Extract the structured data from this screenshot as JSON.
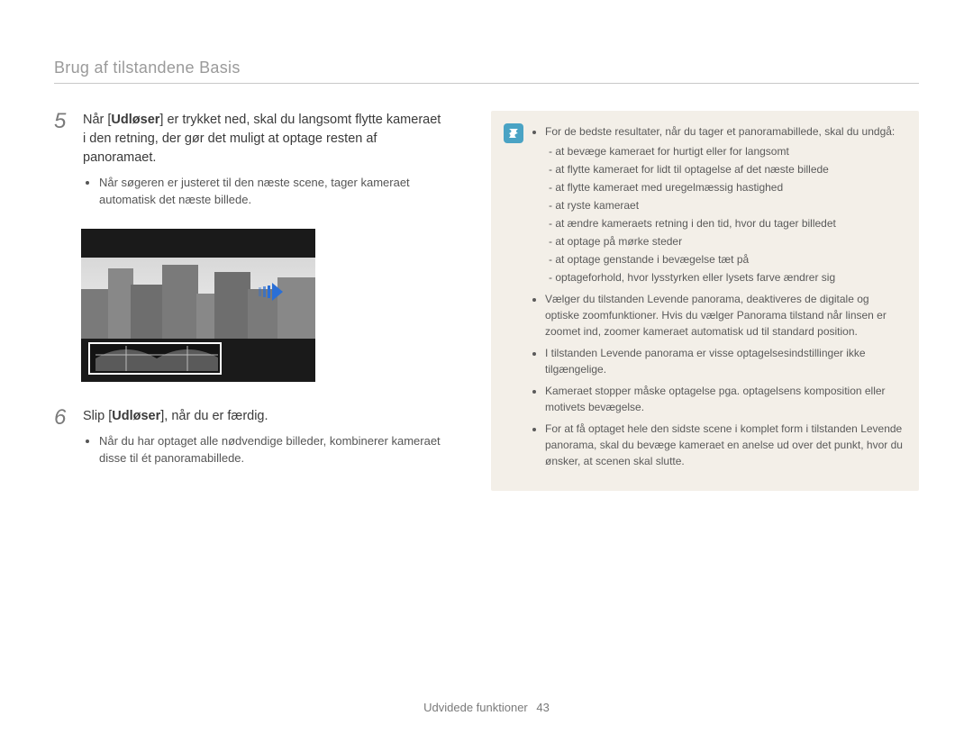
{
  "header": {
    "title": "Brug af tilstandene Basis"
  },
  "steps": {
    "s5": {
      "num": "5",
      "text_pre": "Når [",
      "text_bold": "Udløser",
      "text_post": "] er trykket ned, skal du langsomt flytte kameraet i den retning, der gør det muligt at optage resten af panoramaet.",
      "bullets": [
        "Når søgeren er justeret til den næste scene, tager kameraet automatisk det næste billede."
      ]
    },
    "s6": {
      "num": "6",
      "text_pre": "Slip [",
      "text_bold": "Udløser",
      "text_post": "], når du er færdig.",
      "bullets": [
        "Når du har optaget alle nødvendige billeder, kombinerer kameraet disse til ét panoramabillede."
      ]
    }
  },
  "note": {
    "intro": "For de bedste resultater, når du tager et panoramabillede, skal du undgå:",
    "avoid": [
      "at bevæge kameraet for hurtigt eller for langsomt",
      "at flytte kameraet for lidt til optagelse af det næste billede",
      "at flytte kameraet med uregelmæssig hastighed",
      "at ryste kameraet",
      "at ændre kameraets retning i den tid, hvor du tager billedet",
      "at optage på mørke steder",
      "at optage genstande i bevægelse tæt på",
      "optageforhold, hvor lysstyrken eller lysets farve ændrer sig"
    ],
    "points": [
      "Vælger du tilstanden Levende panorama, deaktiveres de digitale og optiske zoomfunktioner. Hvis du vælger Panorama tilstand når linsen er zoomet ind, zoomer kameraet automatisk ud til standard position.",
      "I tilstanden Levende panorama er visse optagelsesindstillinger ikke tilgængelige.",
      "Kameraet stopper måske optagelse pga. optagelsens komposition eller motivets bevægelse.",
      "For at få optaget hele den sidste scene i komplet form i tilstanden Levende panorama, skal du bevæge kameraet en anelse ud over det punkt, hvor du ønsker, at scenen skal slutte."
    ]
  },
  "footer": {
    "section": "Udvidede funktioner",
    "page": "43"
  },
  "icons": {
    "note": "note-icon",
    "arrow": "arrow-right-icon"
  }
}
